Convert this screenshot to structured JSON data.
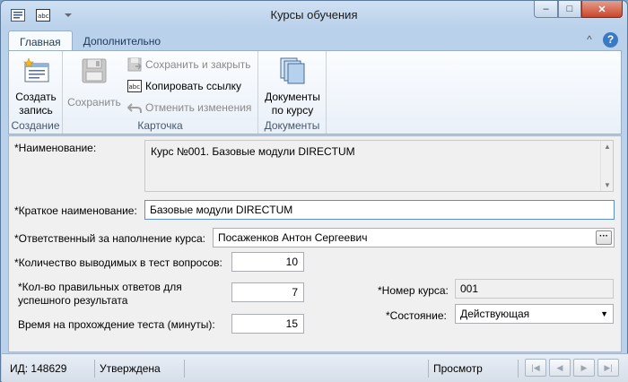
{
  "window": {
    "title": "Курсы обучения",
    "minimize": "‒",
    "maximize": "□",
    "close": "✕"
  },
  "ribbon": {
    "tabs": [
      {
        "label": "Главная",
        "active": true
      },
      {
        "label": "Дополнительно",
        "active": false
      }
    ],
    "collapse_glyph": "^",
    "help_glyph": "?",
    "groups": {
      "create": {
        "label": "Создание",
        "button_line1": "Создать",
        "button_line2": "запись"
      },
      "card": {
        "label": "Карточка",
        "save_label": "Сохранить",
        "save_close_label": "Сохранить и закрыть",
        "copy_link_label": "Копировать ссылку",
        "undo_label": "Отменить изменения"
      },
      "documents": {
        "label": "Документы",
        "button_line1": "Документы",
        "button_line2": "по курсу"
      }
    }
  },
  "form": {
    "name": {
      "label": "*Наименование:",
      "value": "Курс №001. Базовые модули DIRECTUM"
    },
    "short_name": {
      "label": "*Краткое наименование:",
      "value": "Базовые модули DIRECTUM"
    },
    "responsible": {
      "label": "*Ответственный за наполнение курса:",
      "value": "Посаженков Антон Сергеевич",
      "button": "···"
    },
    "question_count": {
      "label": "*Количество выводимых в тест вопросов:",
      "value": "10"
    },
    "correct_answers": {
      "label_line1": "*Кол-во правильных ответов для",
      "label_line2": "успешного результата",
      "value": "7"
    },
    "test_time": {
      "label": "Время на прохождение теста (минуты):",
      "value": "15"
    },
    "course_number": {
      "label": "*Номер курса:",
      "value": "001"
    },
    "state": {
      "label": "*Состояние:",
      "value": "Действующая"
    }
  },
  "status_bar": {
    "id_text": "ИД: 148629",
    "approval": "Утверждена",
    "mode": "Просмотр"
  },
  "colors": {
    "window_frame": "#b9d1ea",
    "close_button": "#c9452b",
    "form_background": "#f0f0f0"
  }
}
